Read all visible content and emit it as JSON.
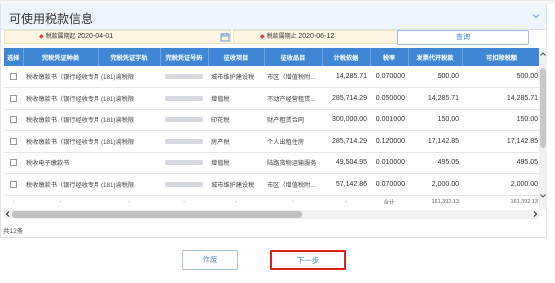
{
  "panel": {
    "title": "可使用税款信息"
  },
  "filters": {
    "start": {
      "label": "税款属期起",
      "value": "2020-04-01"
    },
    "end": {
      "label": "税款属期止",
      "value": "2020-06-12"
    },
    "query_label": "查询"
  },
  "columns": [
    "选择",
    "完税凭证种类",
    "完税凭证字轨",
    "完税凭证号码",
    "征收项目",
    "征收品目",
    "计税依据",
    "税率",
    "发票代开税款",
    "可扣除税额"
  ],
  "rows": [
    {
      "type": "税收缴款书（银行经收专用）",
      "track": "(181)渝税限",
      "project": "城市维护建设税",
      "item": "市区（增值税附...",
      "basis": "14,285.71",
      "rate": "0.070000",
      "tax": "500.00",
      "deduct": "500.00"
    },
    {
      "type": "税收缴款书（银行经收专用）",
      "track": "(181)渝税限",
      "project": "增值税",
      "item": "不动产经营租赁...",
      "basis": "285,714.29",
      "rate": "0.050000",
      "tax": "14,285.71",
      "deduct": "14,285.71"
    },
    {
      "type": "税收缴款书（银行经收专用）",
      "track": "(181)渝税限",
      "project": "印花税",
      "item": "财产租赁合同",
      "basis": "300,000.00",
      "rate": "0.001000",
      "tax": "150.00",
      "deduct": "150.00"
    },
    {
      "type": "税收缴款书（银行经收专用）",
      "track": "(181)渝税限",
      "project": "房产税",
      "item": "个人出租住房",
      "basis": "285,714.29",
      "rate": "0.120000",
      "tax": "17,142.85",
      "deduct": "17,142.85"
    },
    {
      "type": "税收电子缴款书",
      "track": "",
      "project": "增值税",
      "item": "陆路货物运输服务",
      "basis": "49,504.95",
      "rate": "0.010000",
      "tax": "495.05",
      "deduct": "495.05"
    },
    {
      "type": "税收缴款书（银行经收专用）",
      "track": "(181)渝税限",
      "project": "城市维护建设税",
      "item": "市区（增值税附...",
      "basis": "57,142.86",
      "rate": "0.070000",
      "tax": "2,000.00",
      "deduct": "2,000.00"
    }
  ],
  "totals": {
    "dash": "-",
    "label": "合计",
    "tax": "161,392.13",
    "deduct": "161,392.13"
  },
  "footer": {
    "count": "共12条"
  },
  "buttons": {
    "back": "作废",
    "next": "下一步"
  },
  "colors": {
    "header_bg": "#3f86d4",
    "accent": "#4a8ad6",
    "highlight_border": "#e0241a"
  },
  "icons": {
    "collapse": "chevron-down-icon",
    "calendar": "calendar-icon",
    "scroll_left": "arrow-left-icon",
    "scroll_right": "arrow-right-icon",
    "scroll_up": "arrow-up-icon",
    "scroll_down": "arrow-down-icon"
  }
}
